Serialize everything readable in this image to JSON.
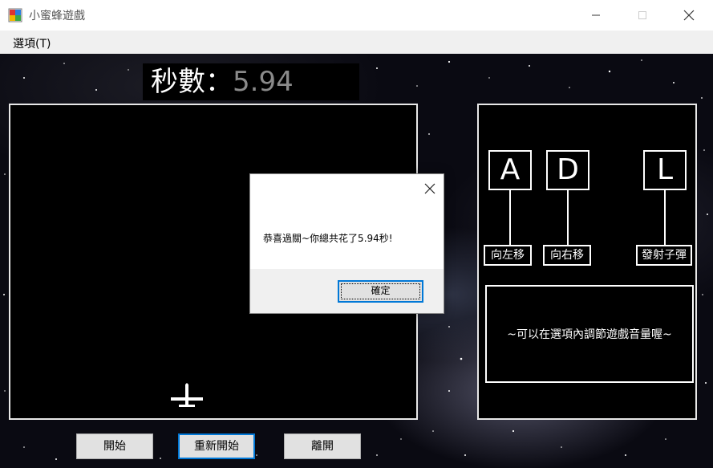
{
  "window": {
    "title": "小蜜蜂遊戲"
  },
  "menu": {
    "options_label": "選項(T)"
  },
  "timer": {
    "label": "秒數：",
    "value": "5.94"
  },
  "controls": [
    {
      "key": "A",
      "action": "向左移"
    },
    {
      "key": "D",
      "action": "向右移"
    },
    {
      "key": "L",
      "action": "發射子彈"
    }
  ],
  "info_text": "~可以在選項內調節遊戲音量喔~",
  "buttons": {
    "start": "開始",
    "restart": "重新開始",
    "exit": "離開"
  },
  "dialog": {
    "message": "恭喜過關~你總共花了5.94秒!",
    "ok_label": "確定"
  },
  "icons": {
    "app": "app-icon",
    "minimize": "minimize-icon",
    "maximize": "maximize-icon",
    "close": "close-icon",
    "player": "plane-icon"
  }
}
